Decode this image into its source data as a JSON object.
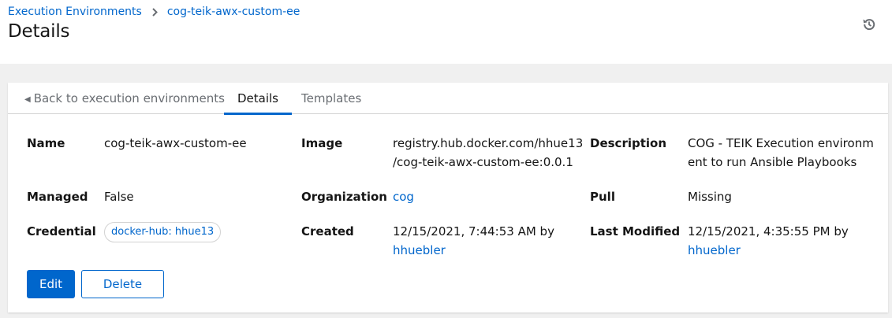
{
  "breadcrumb": {
    "items": [
      {
        "label": "Execution Environments"
      },
      {
        "label": "cog-teik-awx-custom-ee"
      }
    ]
  },
  "page": {
    "title": "Details"
  },
  "header_actions": {
    "history_icon": "history-icon"
  },
  "tabs": [
    {
      "label": "Back to execution environments",
      "icon": "caret-left-icon"
    },
    {
      "label": "Details",
      "active": true
    },
    {
      "label": "Templates"
    }
  ],
  "details": {
    "name": {
      "label": "Name",
      "value": "cog-teik-awx-custom-ee"
    },
    "image": {
      "label": "Image",
      "value_line1": "registry.hub.docker.com/hhue13",
      "value_line2": "/cog-teik-awx-custom-ee:0.0.1"
    },
    "description": {
      "label": "Description",
      "value_line1": "COG - TEIK Execution environm",
      "value_line2": "ent to run Ansible Playbooks"
    },
    "managed": {
      "label": "Managed",
      "value": "False"
    },
    "organization": {
      "label": "Organization",
      "value": "cog"
    },
    "pull": {
      "label": "Pull",
      "value": "Missing"
    },
    "credential": {
      "label": "Credential",
      "value": "docker-hub: hhue13"
    },
    "created": {
      "label": "Created",
      "value": "12/15/2021, 7:44:53 AM by",
      "user": "hhuebler"
    },
    "last_modified": {
      "label": "Last Modified",
      "value": "12/15/2021, 4:35:55 PM by",
      "user": "hhuebler"
    }
  },
  "actions": {
    "edit_label": "Edit",
    "delete_label": "Delete"
  },
  "colors": {
    "link": "#0066cc",
    "primary": "#0066cc",
    "page_bg": "#f0f0f0",
    "text": "#151515"
  }
}
